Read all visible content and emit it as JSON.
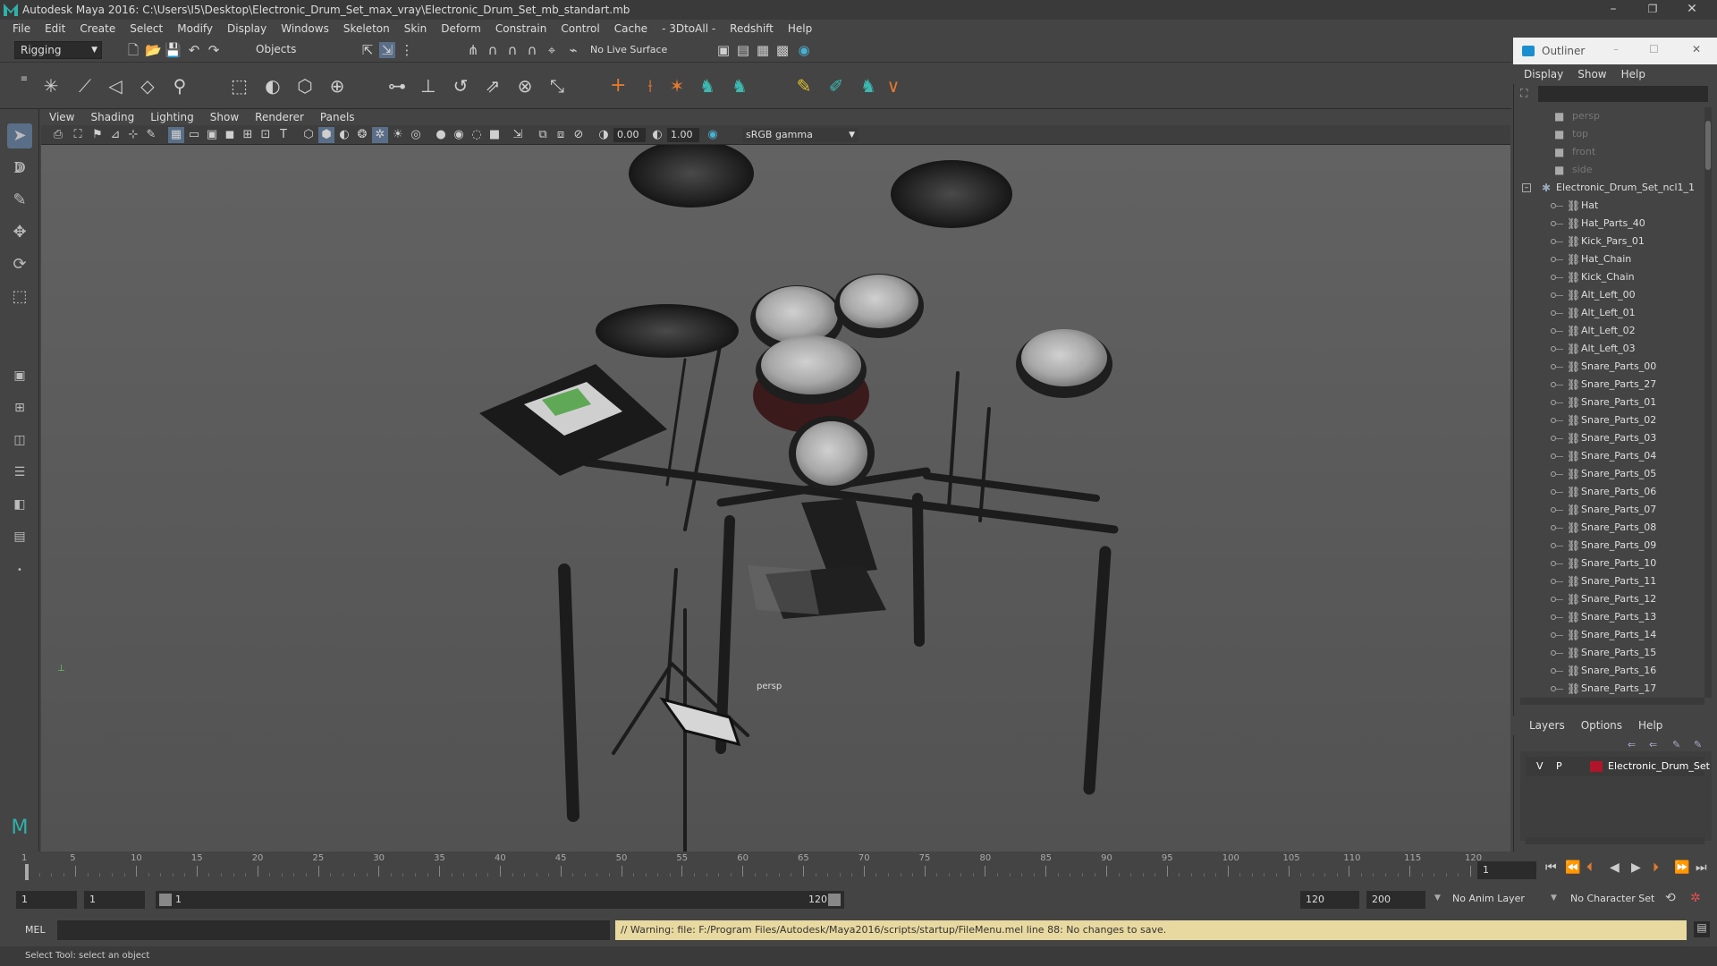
{
  "window": {
    "title": "Autodesk Maya 2016: C:\\Users\\I5\\Desktop\\Electronic_Drum_Set_max_vray\\Electronic_Drum_Set_mb_standart.mb",
    "minimize": "–",
    "restore": "❐",
    "close": "✕"
  },
  "menubar": [
    "File",
    "Edit",
    "Create",
    "Select",
    "Modify",
    "Display",
    "Windows",
    "Skeleton",
    "Skin",
    "Deform",
    "Constrain",
    "Control",
    "Cache",
    "- 3DtoAll -",
    "Redshift",
    "Help"
  ],
  "shelf": {
    "mode": "Rigging",
    "objects_label": "Objects",
    "live_surface": "No Live Surface"
  },
  "viewport": {
    "menus": [
      "View",
      "Shading",
      "Lighting",
      "Show",
      "Renderer",
      "Panels"
    ],
    "exposure": "0.00",
    "gamma": "1.00",
    "color_space": "sRGB gamma",
    "camera_label": "persp"
  },
  "outliner": {
    "title": "Outliner",
    "menus": [
      "Display",
      "Show",
      "Help"
    ],
    "cameras": [
      "persp",
      "top",
      "front",
      "side"
    ],
    "group": "Electronic_Drum_Set_ncl1_1",
    "items": [
      "Hat",
      "Hat_Parts_40",
      "Kick_Pars_01",
      "Hat_Chain",
      "Kick_Chain",
      "Alt_Left_00",
      "Alt_Left_01",
      "Alt_Left_02",
      "Alt_Left_03",
      "Snare_Parts_00",
      "Snare_Parts_27",
      "Snare_Parts_01",
      "Snare_Parts_02",
      "Snare_Parts_03",
      "Snare_Parts_04",
      "Snare_Parts_05",
      "Snare_Parts_06",
      "Snare_Parts_07",
      "Snare_Parts_08",
      "Snare_Parts_09",
      "Snare_Parts_10",
      "Snare_Parts_11",
      "Snare_Parts_12",
      "Snare_Parts_13",
      "Snare_Parts_14",
      "Snare_Parts_15",
      "Snare_Parts_16",
      "Snare_Parts_17"
    ]
  },
  "layers": {
    "menus": [
      "Layers",
      "Options",
      "Help"
    ],
    "layer": {
      "v": "V",
      "p": "P",
      "name": "Electronic_Drum_Set",
      "color": "#b0152a"
    }
  },
  "timeline": {
    "ticks": [
      "1",
      "5",
      "10",
      "15",
      "20",
      "25",
      "30",
      "35",
      "40",
      "45",
      "50",
      "55",
      "60",
      "65",
      "70",
      "75",
      "80",
      "85",
      "90",
      "95",
      "100",
      "105",
      "110",
      "115",
      "120"
    ],
    "current_frame": "1"
  },
  "range": {
    "start": "1",
    "playback_start": "1",
    "slider_start": "1",
    "slider_end": "120",
    "playback_end": "120",
    "end": "200",
    "anim_layer": "No Anim Layer",
    "char_set": "No Character Set"
  },
  "command": {
    "lang": "MEL",
    "warning": "// Warning: file: F:/Program Files/Autodesk/Maya2016/scripts/startup/FileMenu.mel line 88: No changes to save."
  },
  "help_line": "Select Tool: select an object",
  "colors": {
    "accent": "#2fb0a8",
    "warning_bg": "#e8d9a0",
    "layer": "#b0152a"
  }
}
